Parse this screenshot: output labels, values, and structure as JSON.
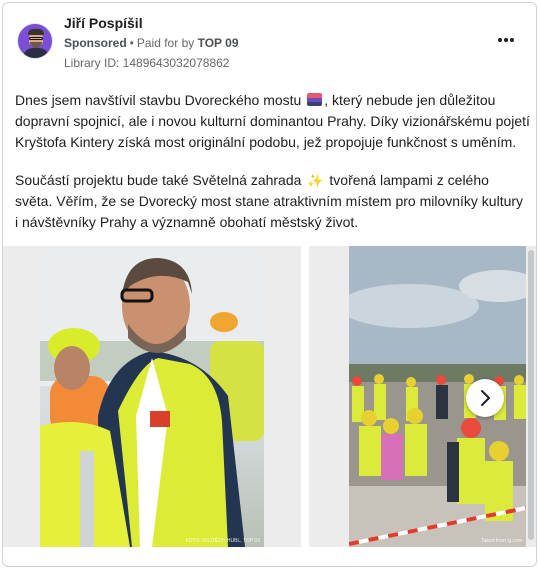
{
  "post": {
    "author": "Jiří Pospíšil",
    "sponsored": "Sponsored",
    "separator": "•",
    "paid_for_prefix": "Paid for by",
    "page": "TOP 09",
    "library_id": "Library ID: 1489643032078862",
    "more_icon": "more-horizontal-icon"
  },
  "text": {
    "p1_a": "Dnes jsem navštívil stavbu Dvoreckého mostu",
    "p1_b": ", který nebude jen důležitou dopravní spojnicí, ale i novou kulturní dominantou Prahy. Díky vizionářskému pojetí Kryštofa Kintery získá most originální podobu, jež propojuje funkčnost s uměním.",
    "p2_a": "Součástí projektu bude také Světelná zahrada",
    "p2_b": " tvořená lampami z celého světa. Věřím, že se Dvorecký most stane atraktivním místem pro milovníky kultury i návštěvníky Prahy a významně obohatí městský život.",
    "sparkle": "✨"
  },
  "carousel": {
    "photo1_credit": "FOTO: VOJTĚCH HUBL, TOP 09",
    "photo2_credit": "Taken from ig.com",
    "next_icon": "chevron-right-icon"
  }
}
